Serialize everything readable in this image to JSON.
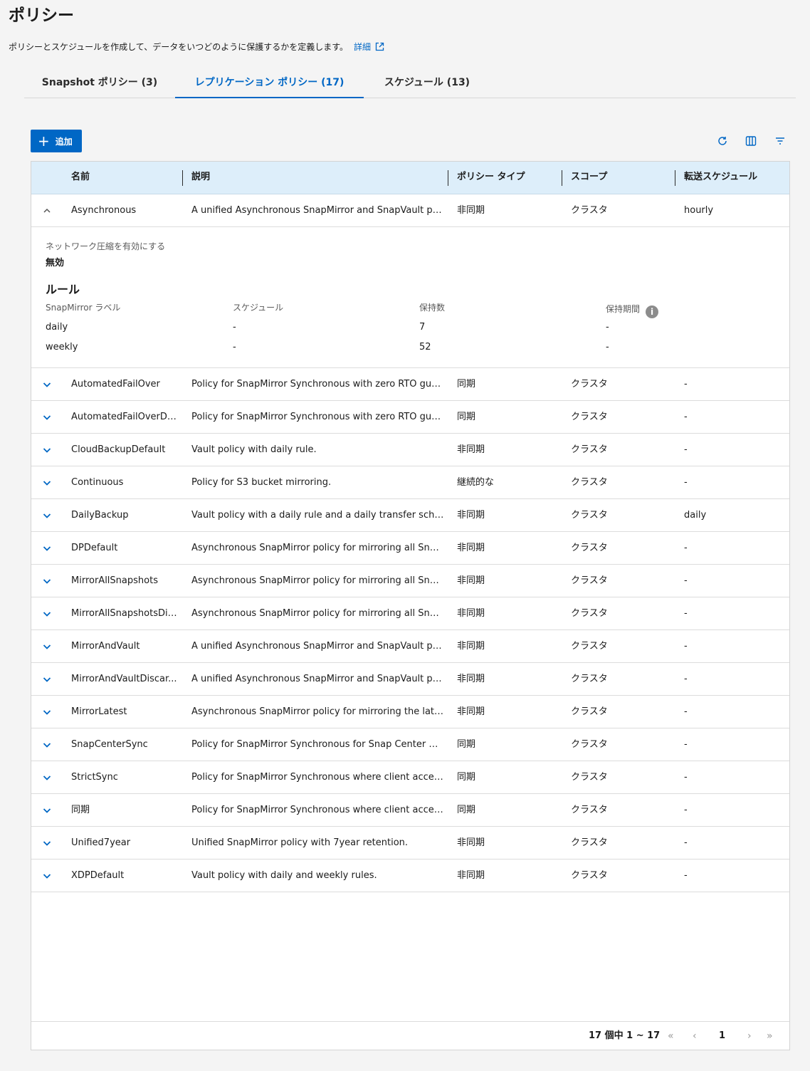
{
  "page": {
    "title": "ポリシー",
    "description": "ポリシーとスケジュールを作成して、データをいつどのように保護するかを定義します。",
    "details_link": "詳細"
  },
  "tabs": [
    {
      "label": "Snapshot ポリシー (3)",
      "active": false
    },
    {
      "label": "レプリケーション ポリシー (17)",
      "active": true
    },
    {
      "label": "スケジュール (13)",
      "active": false
    }
  ],
  "toolbar": {
    "add_label": "追加",
    "icons": [
      "refresh-icon",
      "columns-icon",
      "filter-icon"
    ]
  },
  "table": {
    "columns": [
      "名前",
      "説明",
      "ポリシー タイプ",
      "スコープ",
      "転送スケジュール"
    ],
    "rows": [
      {
        "name": "Asynchronous",
        "description": "A unified Asynchronous SnapMirror and SnapVault polic...",
        "type": "非同期",
        "scope": "クラスタ",
        "transfer": "hourly",
        "expanded": true
      },
      {
        "name": "AutomatedFailOver",
        "description": "Policy for SnapMirror Synchronous with zero RTO guara...",
        "type": "同期",
        "scope": "クラスタ",
        "transfer": "-"
      },
      {
        "name": "AutomatedFailOverDu...",
        "description": "Policy for SnapMirror Synchronous with zero RTO guara...",
        "type": "同期",
        "scope": "クラスタ",
        "transfer": "-"
      },
      {
        "name": "CloudBackupDefault",
        "description": "Vault policy with daily rule.",
        "type": "非同期",
        "scope": "クラスタ",
        "transfer": "-"
      },
      {
        "name": "Continuous",
        "description": "Policy for S3 bucket mirroring.",
        "type": "継続的な",
        "scope": "クラスタ",
        "transfer": "-"
      },
      {
        "name": "DailyBackup",
        "description": "Vault policy with a daily rule and a daily transfer schedu...",
        "type": "非同期",
        "scope": "クラスタ",
        "transfer": "daily"
      },
      {
        "name": "DPDefault",
        "description": "Asynchronous SnapMirror policy for mirroring all Snaps...",
        "type": "非同期",
        "scope": "クラスタ",
        "transfer": "-"
      },
      {
        "name": "MirrorAllSnapshots",
        "description": "Asynchronous SnapMirror policy for mirroring all Snaps...",
        "type": "非同期",
        "scope": "クラスタ",
        "transfer": "-"
      },
      {
        "name": "MirrorAllSnapshotsDis...",
        "description": "Asynchronous SnapMirror policy for mirroring all Snaps...",
        "type": "非同期",
        "scope": "クラスタ",
        "transfer": "-"
      },
      {
        "name": "MirrorAndVault",
        "description": "A unified Asynchronous SnapMirror and SnapVault polic...",
        "type": "非同期",
        "scope": "クラスタ",
        "transfer": "-"
      },
      {
        "name": "MirrorAndVaultDiscar...",
        "description": "A unified Asynchronous SnapMirror and SnapVault polic...",
        "type": "非同期",
        "scope": "クラスタ",
        "transfer": "-"
      },
      {
        "name": "MirrorLatest",
        "description": "Asynchronous SnapMirror policy for mirroring the latest...",
        "type": "非同期",
        "scope": "クラスタ",
        "transfer": "-"
      },
      {
        "name": "SnapCenterSync",
        "description": "Policy for SnapMirror Synchronous for Snap Center with...",
        "type": "同期",
        "scope": "クラスタ",
        "transfer": "-"
      },
      {
        "name": "StrictSync",
        "description": "Policy for SnapMirror Synchronous where client access ...",
        "type": "同期",
        "scope": "クラスタ",
        "transfer": "-"
      },
      {
        "name": "同期",
        "description": "Policy for SnapMirror Synchronous where client access ...",
        "type": "同期",
        "scope": "クラスタ",
        "transfer": "-"
      },
      {
        "name": "Unified7year",
        "description": "Unified SnapMirror policy with 7year retention.",
        "type": "非同期",
        "scope": "クラスタ",
        "transfer": "-"
      },
      {
        "name": "XDPDefault",
        "description": "Vault policy with daily and weekly rules.",
        "type": "非同期",
        "scope": "クラスタ",
        "transfer": "-"
      }
    ]
  },
  "detail": {
    "compression_label": "ネットワーク圧縮を有効にする",
    "compression_value": "無効",
    "rules_title": "ルール",
    "rule_columns": [
      "SnapMirror ラベル",
      "スケジュール",
      "保持数",
      "保持期間"
    ],
    "rules": [
      {
        "label": "daily",
        "schedule": "-",
        "count": "7",
        "period": "-"
      },
      {
        "label": "weekly",
        "schedule": "-",
        "count": "52",
        "period": "-"
      }
    ]
  },
  "pagination": {
    "summary": "17 個中 1 ~ 17",
    "current_page": "1"
  },
  "colors": {
    "accent": "#0067c5",
    "header_bg": "#ddeefa"
  }
}
